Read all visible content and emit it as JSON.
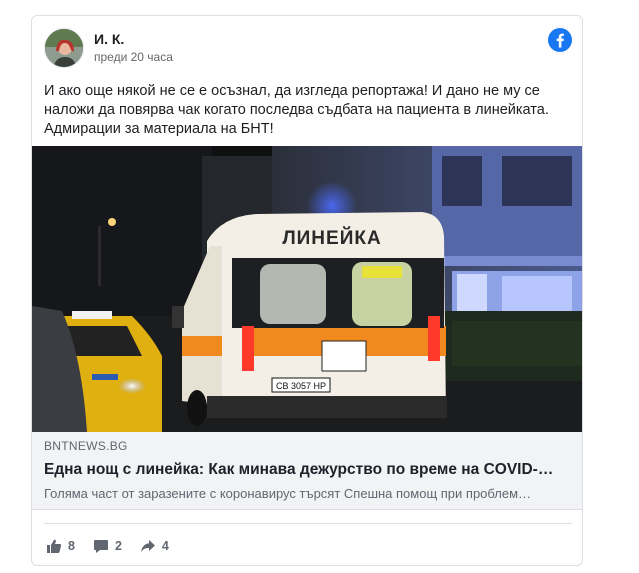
{
  "post": {
    "author": "И. К.",
    "timestamp": "преди 20 часа",
    "text": "И ако още някой не се е осъзнал, да изгледа репортажа! И дано не му се наложи да повярва чак когато последва съдбата на пациента в линейката. Адмирации за материала на БНТ!"
  },
  "link": {
    "domain": "BNTNEWS.BG",
    "title": "Една нощ с линейка: Как минава дежурство по време на COVID-…",
    "description": "Голяма част от заразените с коронавирус търсят Спешна помощ при проблем…",
    "image_ambulance_text": "ЛИНЕЙКА",
    "image_plate_text": "СВ 3057 НР"
  },
  "actions": {
    "likes": "8",
    "comments": "2",
    "shares": "4"
  },
  "colors": {
    "facebook_blue": "#1877f2",
    "meta_background": "#f2f3f5",
    "secondary_text": "#606770"
  },
  "icons": {
    "logo": "facebook-logo-icon",
    "like": "thumbs-up-icon",
    "comment": "speech-bubble-icon",
    "share": "share-arrow-icon"
  }
}
